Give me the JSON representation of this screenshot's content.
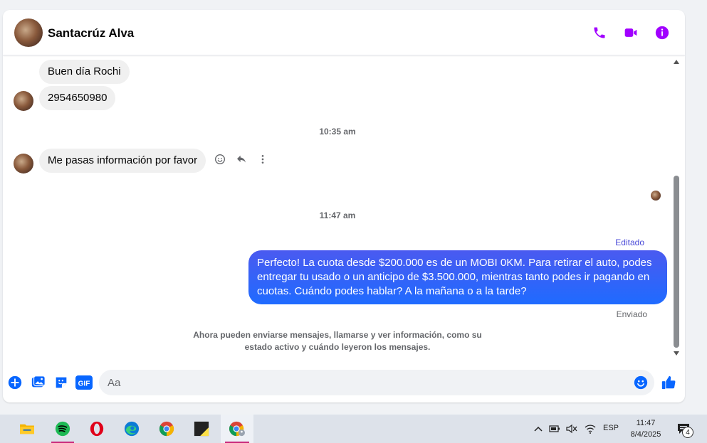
{
  "chat": {
    "contact_name": "Santacrúz Alva",
    "messages": {
      "m1": "Buen día Rochi",
      "m2": "2954650980",
      "time1": "10:35 am",
      "m3": "Me pasas información por favor",
      "time2": "11:47 am",
      "edited_label": "Editado",
      "own_message": "Perfecto! La cuota desde $200.000 es de un MOBI 0KM. Para retirar el auto, podes entregar tu usado o un anticipo de $3.500.000, mientras tanto podes ir pagando en cuotas. Cuándo podes hablar? A la mañana o a la tarde?",
      "sent_label": "Enviado",
      "notice": "Ahora pueden enviarse mensajes, llamarse y ver información, como su estado activo y cuándo leyeron los mensajes."
    },
    "composer": {
      "placeholder": "Aa",
      "gif_label": "GIF"
    },
    "accent_color": "#a100ff",
    "bubble_color": "#2b63f7"
  },
  "taskbar": {
    "language": "ESP",
    "time": "11:47",
    "date": "8/4/2025",
    "notification_count": "4",
    "apps": [
      "file-explorer",
      "spotify",
      "opera",
      "edge",
      "chrome",
      "sticky-notes",
      "chrome-profile"
    ]
  }
}
